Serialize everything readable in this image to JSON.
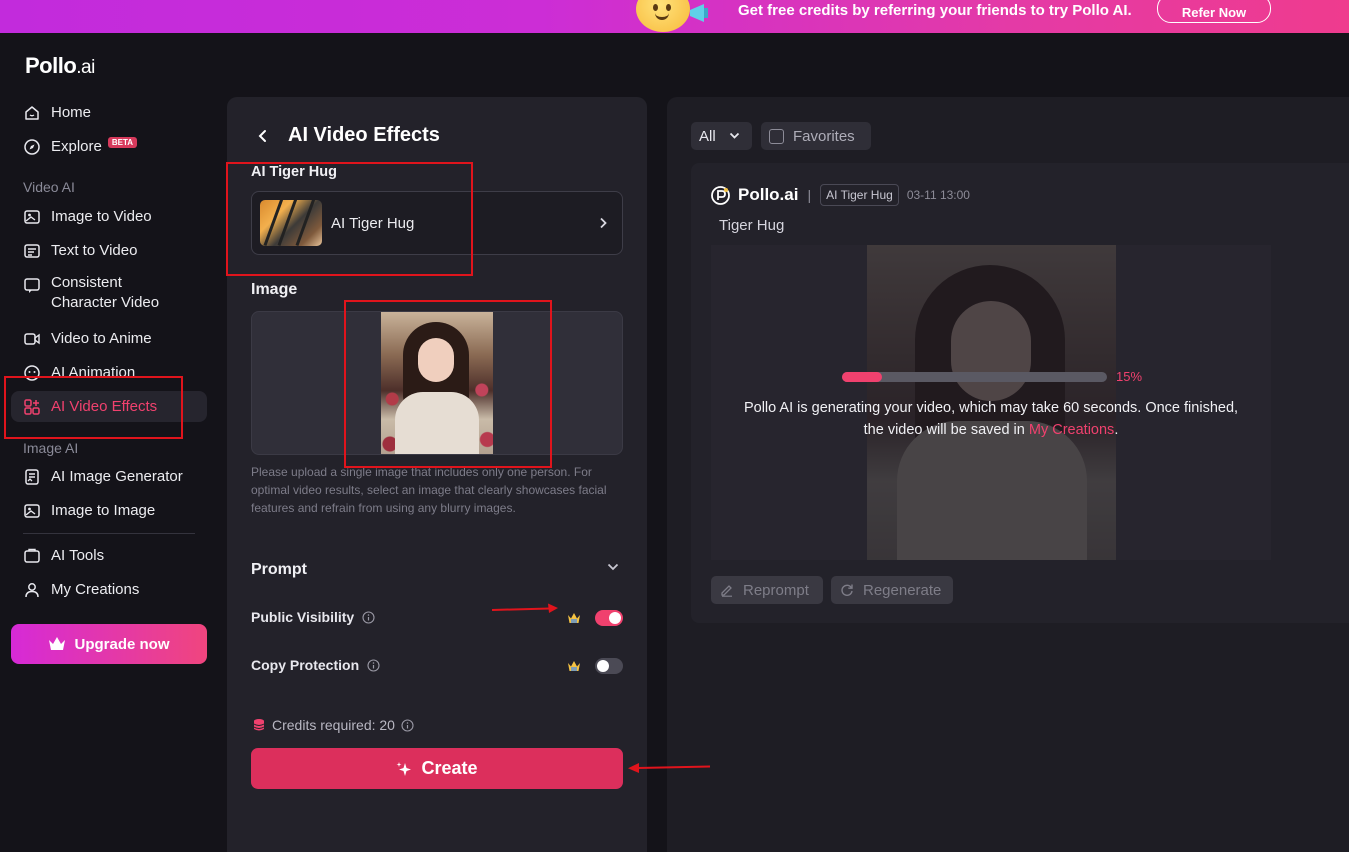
{
  "banner": {
    "text": "Get free credits by referring your friends to try Pollo AI.",
    "refer_label": "Refer Now"
  },
  "sidebar": {
    "logo_main": "Pollo",
    "logo_suffix": ".ai",
    "home": "Home",
    "explore": "Explore",
    "beta": "BETA",
    "section_video": "Video AI",
    "image_to_video": "Image to Video",
    "text_to_video": "Text to Video",
    "consistent_line1": "Consistent",
    "consistent_line2": "Character Video",
    "video_to_anime": "Video to Anime",
    "ai_animation": "AI Animation",
    "ai_video_effects": "AI Video Effects",
    "section_image": "Image AI",
    "ai_image_generator": "AI Image Generator",
    "image_to_image": "Image to Image",
    "ai_tools": "AI Tools",
    "my_creations": "My Creations",
    "upgrade": "Upgrade now"
  },
  "form": {
    "title": "AI Video Effects",
    "effect_label": "AI Tiger Hug",
    "effect_name": "AI Tiger Hug",
    "image_label": "Image",
    "hint": "Please upload a single image that includes only one person. For optimal video results, select an image that clearly showcases facial features and refrain from using any blurry images.",
    "prompt_label": "Prompt",
    "public_visibility": "Public Visibility",
    "public_visibility_on": true,
    "copy_protection": "Copy Protection",
    "copy_protection_on": false,
    "credits": "Credits required: 20",
    "create": "Create"
  },
  "results": {
    "filter_value": "All",
    "favorites": "Favorites",
    "brand": "Pollo.ai",
    "separator": "|",
    "tag": "AI Tiger Hug",
    "time": "03-11 13:00",
    "title": "Tiger Hug",
    "progress_pct": "15%",
    "progress_value": 0.15,
    "message": "Pollo AI is generating your video, which may take 60 seconds. Once finished, the video will be saved in ",
    "message_link": "My Creations",
    "message_end": ".",
    "reprompt": "Reprompt",
    "regenerate": "Regenerate"
  },
  "colors": {
    "accent": "#f0416e",
    "create_button": "#dc2f5c",
    "annotation_red": "#e0141c"
  }
}
